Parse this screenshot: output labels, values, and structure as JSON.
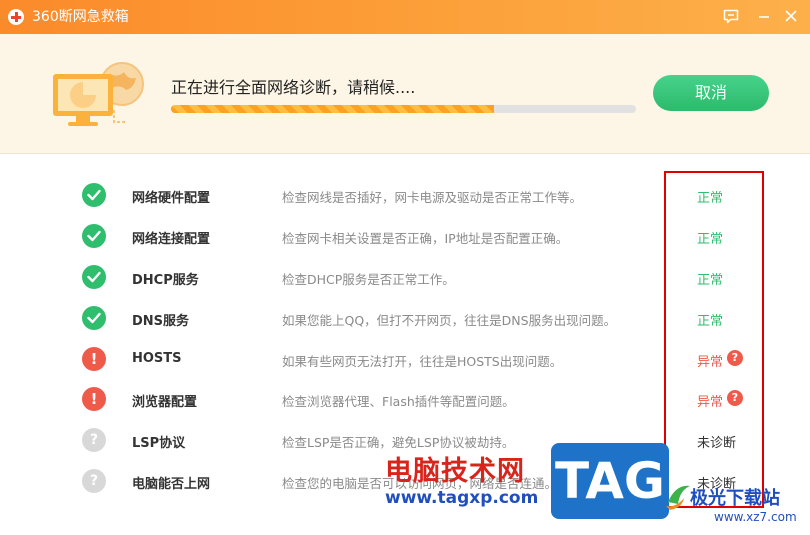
{
  "window": {
    "title": "360断网急救箱"
  },
  "header": {
    "status_text": "正在进行全面网络诊断，请稍候....",
    "progress_fraction": 0.695,
    "cancel_label": "取消"
  },
  "colors": {
    "titlebar": "#fb8a2a",
    "ok": "#2fbd6e",
    "error": "#ef5b4b",
    "pending": "#d8d8d8",
    "highlight": "#e00000"
  },
  "items": [
    {
      "name": "网络硬件配置",
      "desc": "检查网线是否插好，网卡电源及驱动是否正常工作等。",
      "result": "正常",
      "state": "ok"
    },
    {
      "name": "网络连接配置",
      "desc": "检查网卡相关设置是否正确，IP地址是否配置正确。",
      "result": "正常",
      "state": "ok"
    },
    {
      "name": "DHCP服务",
      "desc": "检查DHCP服务是否正常工作。",
      "result": "正常",
      "state": "ok"
    },
    {
      "name": "DNS服务",
      "desc": "如果您能上QQ，但打不开网页，往往是DNS服务出现问题。",
      "result": "正常",
      "state": "ok"
    },
    {
      "name": "HOSTS",
      "desc": "如果有些网页无法打开，往往是HOSTS出现问题。",
      "result": "异常",
      "state": "err"
    },
    {
      "name": "浏览器配置",
      "desc": "检查浏览器代理、Flash插件等配置问题。",
      "result": "异常",
      "state": "err"
    },
    {
      "name": "LSP协议",
      "desc": "检查LSP是否正确，避免LSP协议被劫持。",
      "result": "未诊断",
      "state": "pending"
    },
    {
      "name": "电脑能否上网",
      "desc": "检查您的电脑是否可以访问网页，网络是否连通。",
      "result": "未诊断",
      "state": "pending"
    }
  ],
  "watermark": {
    "text": "电脑技术网",
    "url": "www.tagxp.com",
    "tag": "TAG",
    "site": "极光下载站",
    "site_url": "www.xz7.com"
  }
}
